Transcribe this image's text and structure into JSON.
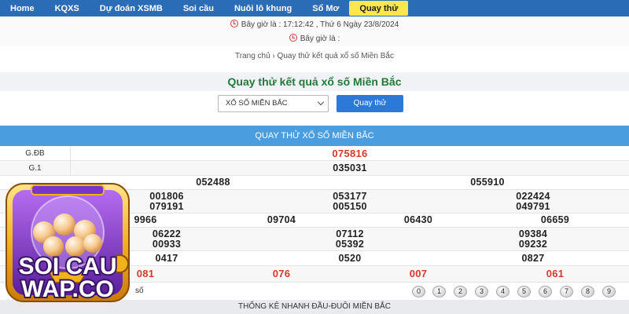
{
  "nav": {
    "items": [
      {
        "label": "Home"
      },
      {
        "label": "KQXS"
      },
      {
        "label": "Dự đoán XSMB"
      },
      {
        "label": "Soi cầu"
      },
      {
        "label": "Nuôi lô khung"
      },
      {
        "label": "Sổ Mơ"
      },
      {
        "label": "Quay thử",
        "active": true
      }
    ]
  },
  "info": {
    "time_line": "Bây giờ là : 17:12:42 , Thứ 6 Ngày 23/8/2024",
    "time_line2": "Bây giờ là :"
  },
  "breadcrumb": "Trang chủ › Quay thử kết quả xổ số Miền Bắc",
  "page_title": "Quay thử kết quả xổ số Miền Bắc",
  "form": {
    "select_value": "XỔ SỐ MIỀN BẮC",
    "button_label": "Quay thử"
  },
  "results": {
    "header": "QUAY THỬ XỔ SỐ MIỀN BẮC",
    "gdb_label": "G.ĐB",
    "gdb": "075816",
    "g1_label": "G.1",
    "g1": "035031",
    "g2": [
      "052488",
      "055910"
    ],
    "g3_row1": [
      "001806",
      "053177",
      "022424"
    ],
    "g3_row2": [
      "079191",
      "005150",
      "049791"
    ],
    "g4": [
      "9966",
      "09704",
      "06430",
      "06659"
    ],
    "g5_row1": [
      "06222",
      "07112",
      "09384"
    ],
    "g5_row2": [
      "00933",
      "05392",
      "09232"
    ],
    "g6": [
      "0417",
      "0520",
      "0827"
    ],
    "g7": [
      "081",
      "076",
      "007",
      "061"
    ]
  },
  "stats": {
    "label": "số",
    "balls": [
      "0",
      "1",
      "2",
      "3",
      "4",
      "5",
      "6",
      "7",
      "8",
      "9"
    ],
    "footer": "THỐNG KÊ NHANH ĐẦU-ĐUÔI MIỀN BẮC"
  },
  "logo": {
    "line1": "SOI CAU",
    "line2": "WAP.CO"
  },
  "colors": {
    "nav_bg": "#2b6cb6",
    "active_tab": "#fde74c",
    "title_green": "#227a37",
    "section_header": "#4a9ee0",
    "prize_red": "#d43a2b"
  }
}
